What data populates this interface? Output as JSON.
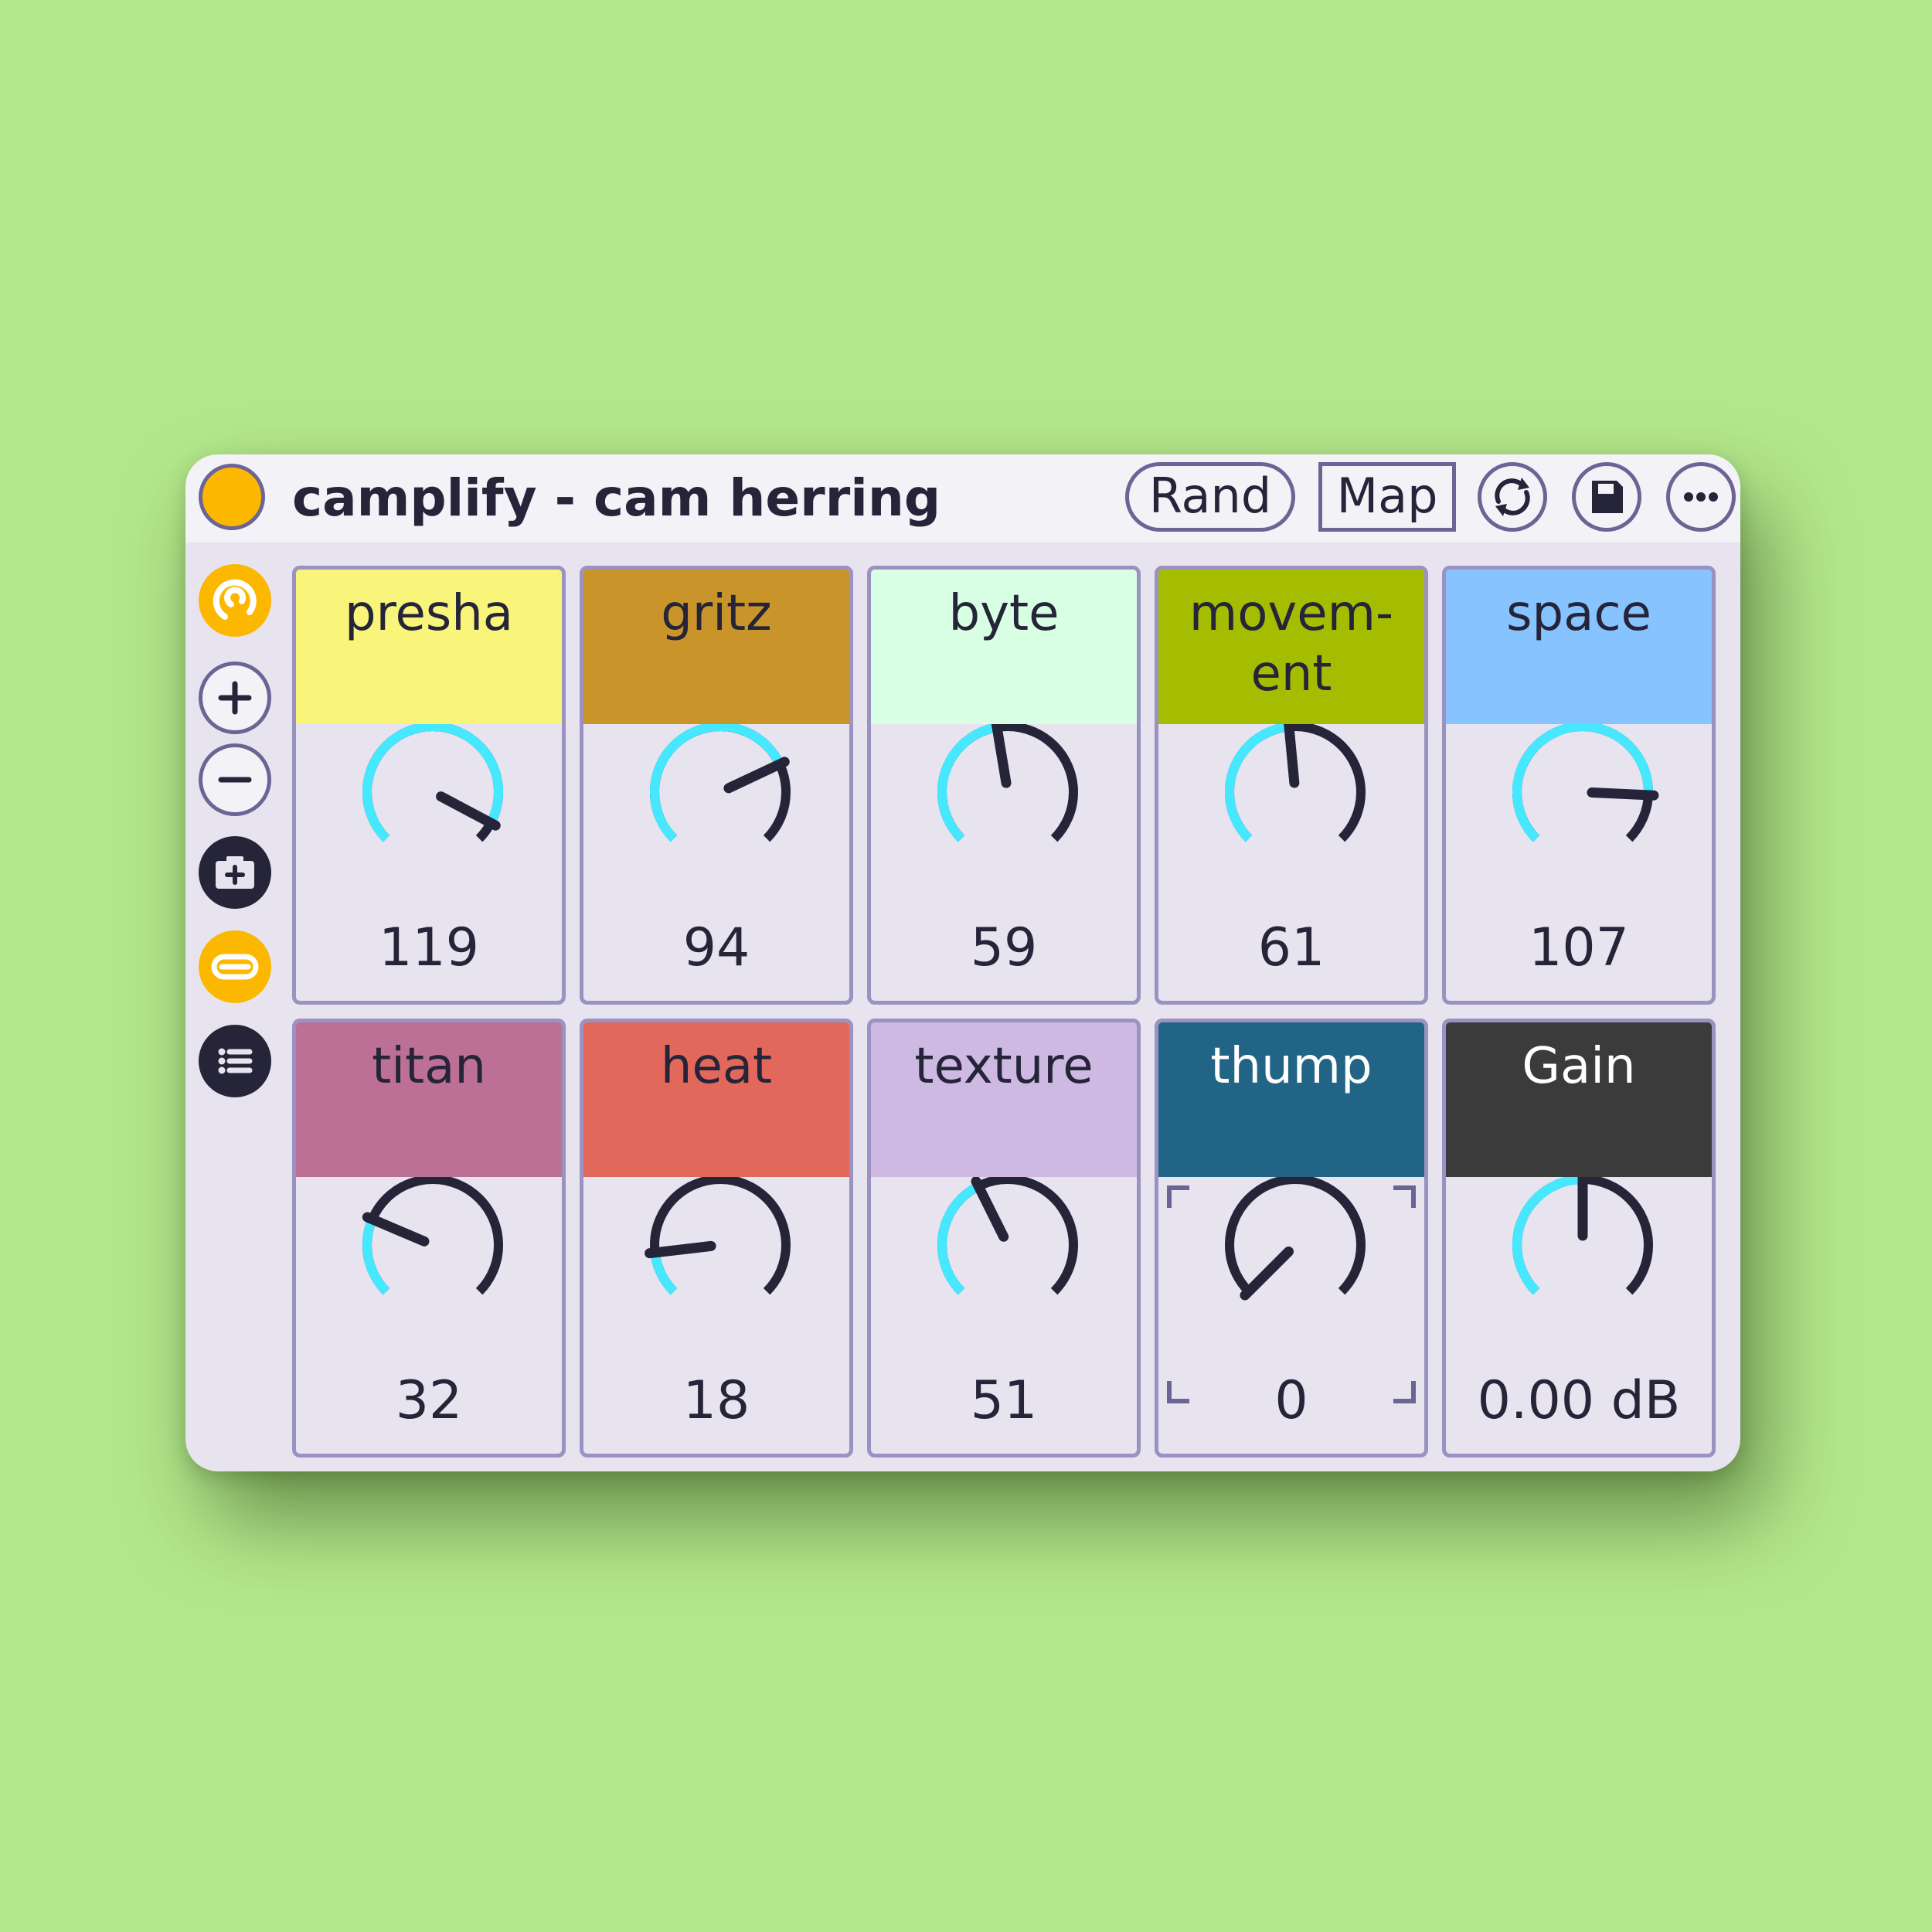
{
  "device": {
    "title": "camplify - cam herring",
    "buttons": {
      "rand_label": "Rand",
      "map_label": "Map"
    },
    "icons": {
      "power": "power-icon",
      "sync": "sync-icon",
      "save": "save-icon",
      "more": "more-icon"
    },
    "colors": {
      "accent": "#fcb800",
      "knob_arc": "#45e8ff",
      "knob_track": "#252438",
      "outline": "#6b6495"
    }
  },
  "sidebar": {
    "icons": [
      "loop-icon",
      "zoom-in-icon",
      "zoom-out-icon",
      "snapshot-add-icon",
      "collapse-icon",
      "list-icon"
    ]
  },
  "macros": [
    {
      "label": "presha",
      "value_text": "119",
      "level": 0.937,
      "header_color": "#f8f57a",
      "label_color": "#252438"
    },
    {
      "label": "gritz",
      "value_text": "94",
      "level": 0.74,
      "header_color": "#c9952a",
      "label_color": "#252438"
    },
    {
      "label": "byte",
      "value_text": "59",
      "level": 0.465,
      "header_color": "#d8ffe3",
      "label_color": "#252438"
    },
    {
      "label": "movem-\nent",
      "value_text": "61",
      "level": 0.48,
      "header_color": "#a5bd00",
      "label_color": "#252438"
    },
    {
      "label": "space",
      "value_text": "107",
      "level": 0.843,
      "header_color": "#86c3ff",
      "label_color": "#252438"
    },
    {
      "label": "titan",
      "value_text": "32",
      "level": 0.252,
      "header_color": "#bc7095",
      "label_color": "#252438"
    },
    {
      "label": "heat",
      "value_text": "18",
      "level": 0.142,
      "header_color": "#e2685b",
      "label_color": "#252438"
    },
    {
      "label": "texture",
      "value_text": "51",
      "level": 0.402,
      "header_color": "#cdb9e2",
      "label_color": "#252438"
    },
    {
      "label": "thump",
      "value_text": "0",
      "level": 0.0,
      "header_color": "#226486",
      "label_color": "#ffffff",
      "focused": true
    },
    {
      "label": "Gain",
      "value_text": "0.00 dB",
      "level": 0.5,
      "header_color": "#3b3b3b",
      "label_color": "#ffffff"
    }
  ]
}
